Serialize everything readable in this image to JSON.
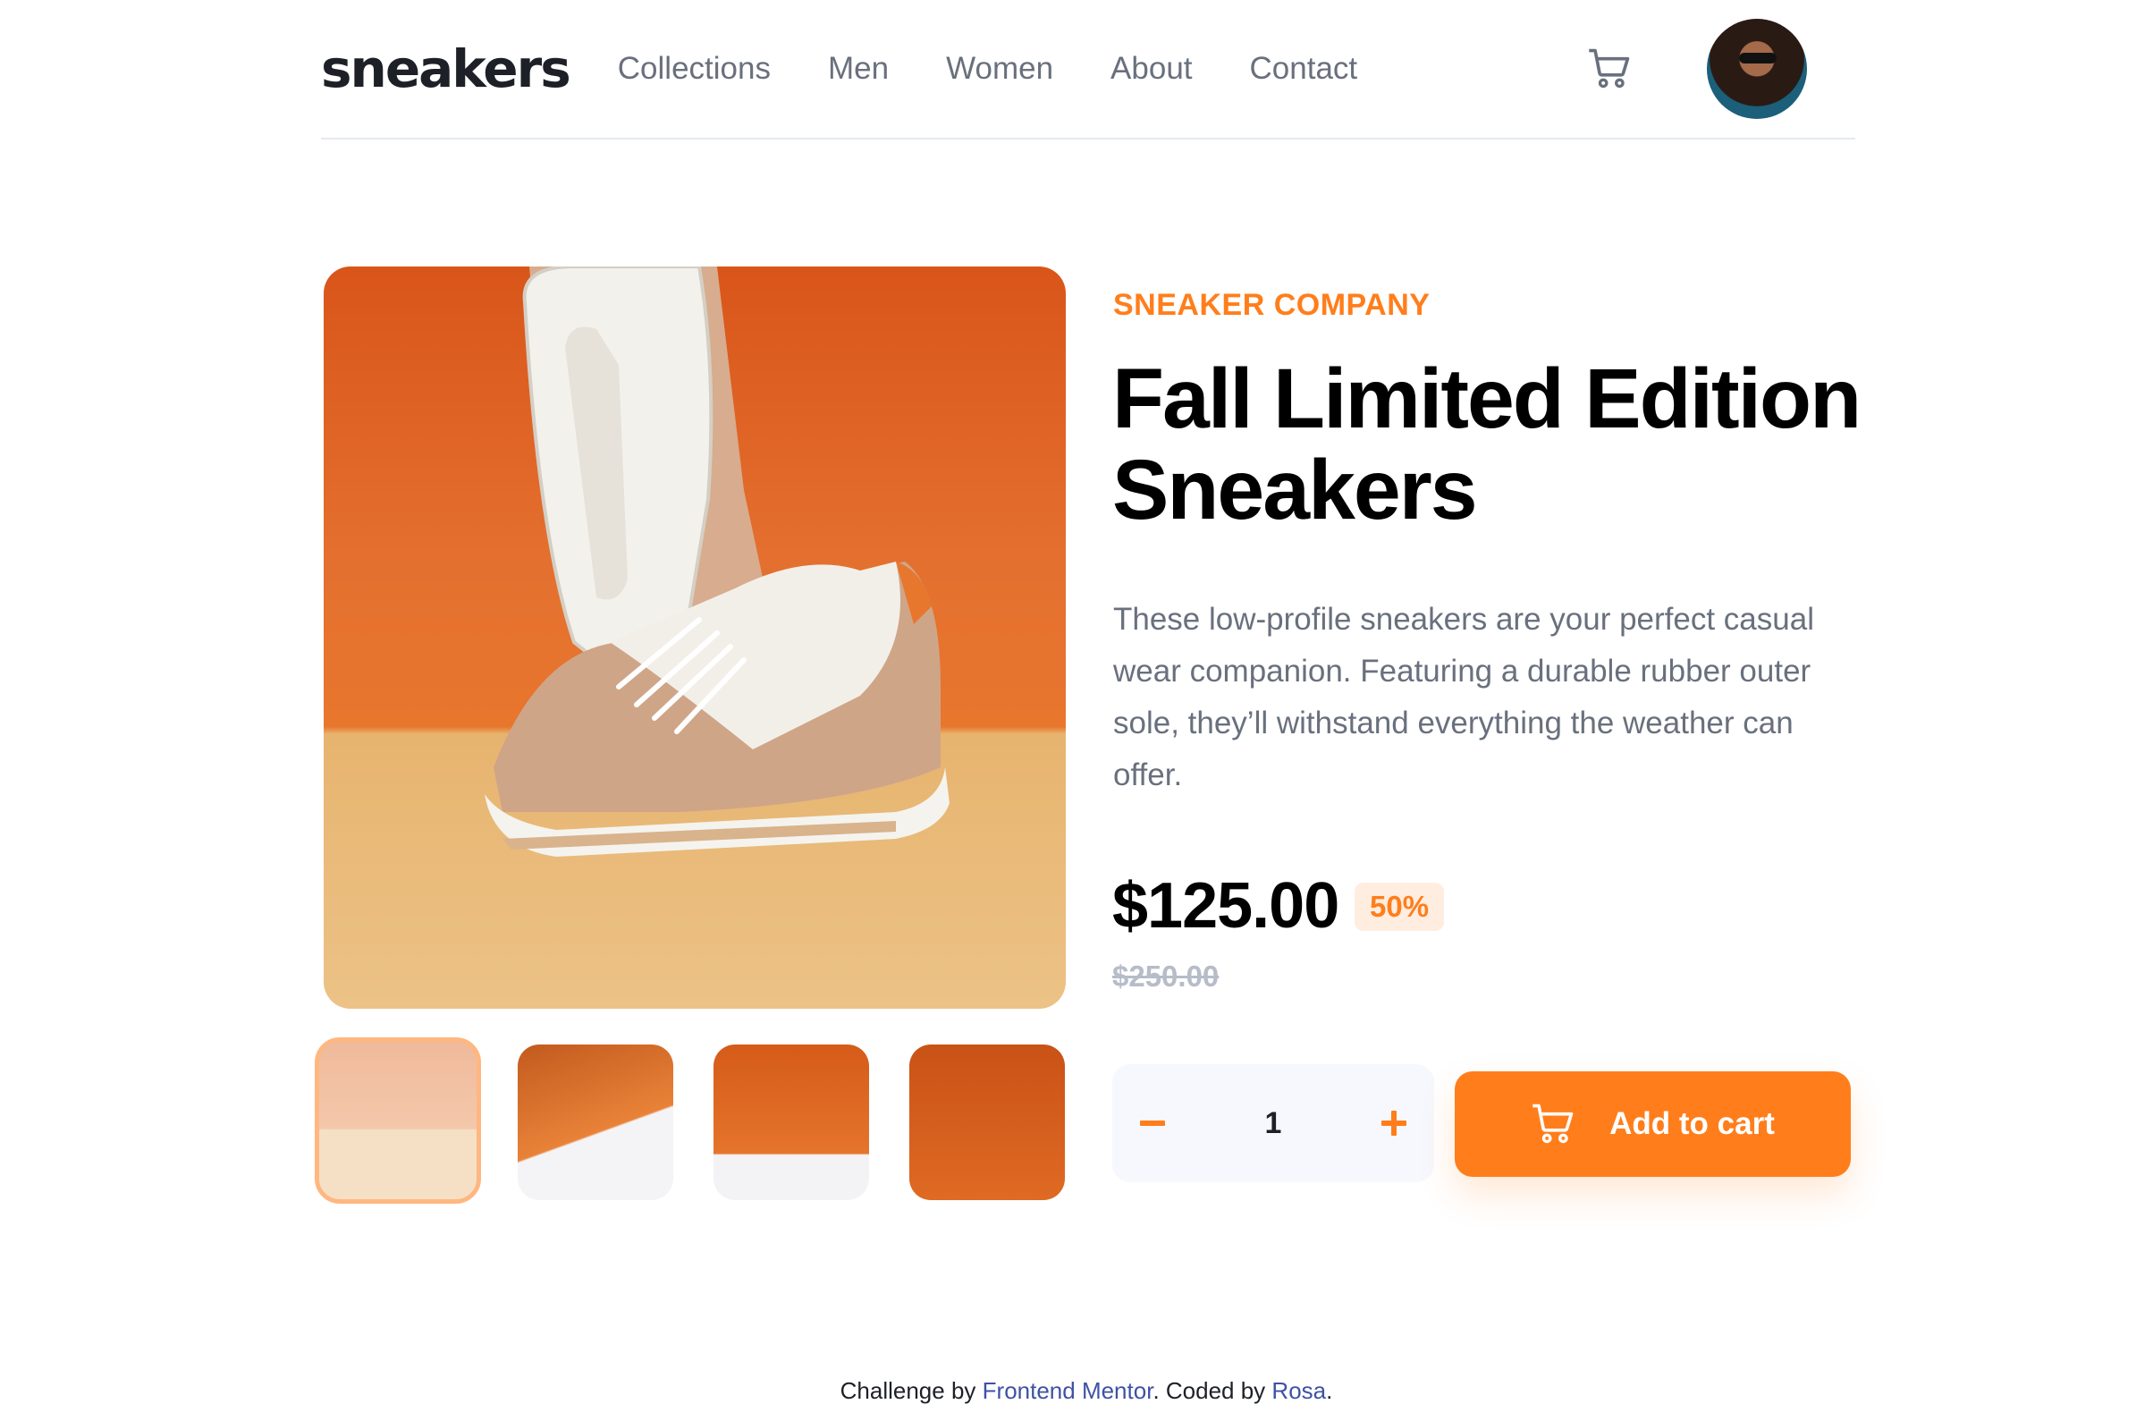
{
  "header": {
    "logo": "sneakers",
    "nav": [
      {
        "label": "Collections"
      },
      {
        "label": "Men"
      },
      {
        "label": "Women"
      },
      {
        "label": "About"
      },
      {
        "label": "Contact"
      }
    ],
    "cart_icon": "cart-icon",
    "avatar_icon": "avatar"
  },
  "gallery": {
    "main_image_alt": "sneaker-product-image",
    "thumbnails": [
      {
        "name": "thumbnail-1",
        "active": true
      },
      {
        "name": "thumbnail-2",
        "active": false
      },
      {
        "name": "thumbnail-3",
        "active": false
      },
      {
        "name": "thumbnail-4",
        "active": false
      }
    ]
  },
  "product": {
    "company": "SNEAKER COMPANY",
    "title": "Fall Limited Edition Sneakers",
    "description": "These low-profile sneakers are your perfect casual wear companion. Featuring a durable rubber outer sole, they’ll withstand everything the weather can offer.",
    "price": "$125.00",
    "discount": "50%",
    "old_price": "$250.00",
    "quantity": "1",
    "minus_icon": "minus-icon",
    "plus_icon": "plus-icon",
    "add_to_cart_label": "Add to cart"
  },
  "attribution": {
    "prefix": "Challenge by",
    "link1": "Frontend Mentor",
    "middle": ". Coded by",
    "link2": "Rosa",
    "suffix": "."
  },
  "colors": {
    "accent": "#ff7e1b",
    "accent_pale": "#ffede0",
    "dark": "#1d2026",
    "grey": "#69707d",
    "light_bg": "#f6f8fd",
    "link": "#3e52a3"
  }
}
